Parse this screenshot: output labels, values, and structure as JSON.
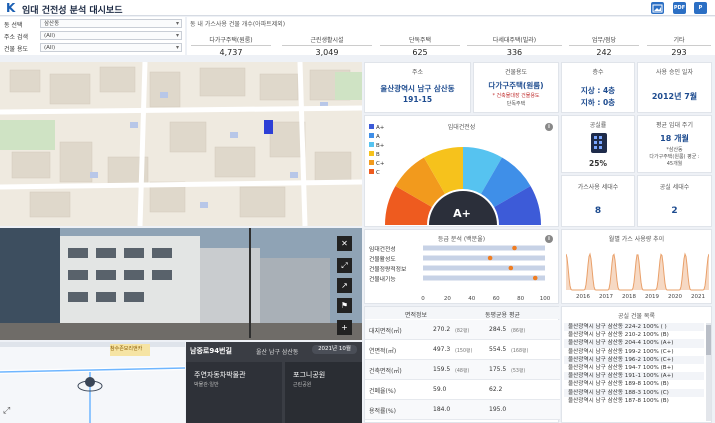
{
  "header": {
    "logo": "K",
    "title": "임대 건전성 분석 대시보드",
    "icons": [
      "image-icon",
      "pdf-icon",
      "ppt-icon"
    ]
  },
  "filters": [
    {
      "label": "동 선택",
      "value": "삼산동"
    },
    {
      "label": "주소 검색",
      "value": "(All)"
    },
    {
      "label": "건물 용도",
      "value": "(All)"
    }
  ],
  "counts": {
    "title": "동 내 가스사용 건물 개수(아파트제외)",
    "columns": [
      {
        "label": "다가구주택(원룸)",
        "value": "4,737"
      },
      {
        "label": "근린생활시설",
        "value": "3,049"
      },
      {
        "label": "단독주택",
        "value": "625"
      },
      {
        "label": "다세대주택(빌라)",
        "value": "336"
      },
      {
        "label": "업무/점당",
        "value": "242"
      },
      {
        "label": "기타",
        "value": "293"
      }
    ]
  },
  "street": {
    "road_label": "남중로94번길",
    "address": "울산 남구 삼산동",
    "date": "2021년 10월",
    "poi1": "주연자동차박물관",
    "poi1_sub": "박물관·일반",
    "poi2": "포그니공원",
    "poi2_sub": "근린공원",
    "map_label": "참수존모리앤카"
  },
  "address_card": {
    "label": "주소",
    "line1": "울산광역시 남구 삼산동",
    "line2": "191-15"
  },
  "use_card": {
    "label": "건물용도",
    "line1": "다가구주택(원룸)",
    "line2": "* 건축물대장 건물용도",
    "line3": "단독주택"
  },
  "floor_card": {
    "label": "층수",
    "above": "지상 : 4층",
    "below": "지하 : 0층"
  },
  "approval_card": {
    "label": "사용 승인 일자",
    "value": "2012년 7월"
  },
  "health": {
    "title": "임대건전성",
    "grade": "A+",
    "legend": [
      "A+",
      "A",
      "B+",
      "B",
      "C+",
      "C"
    ],
    "colors": [
      "#3d5bd8",
      "#3f8fe8",
      "#56c3f0",
      "#f6c21c",
      "#f29a1d",
      "#ee5b1f"
    ]
  },
  "vacancy": {
    "label": "공실률",
    "value": "25%"
  },
  "lease": {
    "label": "평균 임대 주기",
    "value": "18 개월",
    "note1": "*삼산동",
    "note2": "다가구주택(원룸) 평균 :",
    "note3": "45개월"
  },
  "households": {
    "gas_label": "가스사용 세대수",
    "gas_value": "8",
    "vacant_label": "공실 세대수",
    "vacant_value": "2"
  },
  "grade_analysis": {
    "title": "등급 분석 (백분율)",
    "rows": [
      "임대건전성",
      "건물활성도",
      "건물정량적정보",
      "건물내기능"
    ],
    "axis": [
      "0",
      "20",
      "40",
      "60",
      "80",
      "100"
    ],
    "values": [
      75,
      55,
      72,
      92
    ]
  },
  "gas_trend": {
    "title": "월별 가스 사용량 추이",
    "years": [
      "2016",
      "2017",
      "2018",
      "2019",
      "2020",
      "2021"
    ]
  },
  "area_table": {
    "col1": "면적정보",
    "col2": "동평균용 평균",
    "rows": [
      {
        "label": "대지면적(㎡)",
        "v1": "270.2",
        "u1": "(82평)",
        "v2": "284.5",
        "u2": "(86평)"
      },
      {
        "label": "연면적(㎡)",
        "v1": "497.3",
        "u1": "(150평)",
        "v2": "554.5",
        "u2": "(168평)"
      },
      {
        "label": "건축면적(㎡)",
        "v1": "159.5",
        "u1": "(48평)",
        "v2": "175.5",
        "u2": "(53평)"
      },
      {
        "label": "건폐율(%)",
        "v1": "59.0",
        "u1": "",
        "v2": "62.2",
        "u2": ""
      },
      {
        "label": "용적률(%)",
        "v1": "184.0",
        "u1": "",
        "v2": "195.0",
        "u2": ""
      }
    ]
  },
  "similar": {
    "title": "공실 건물 목록",
    "items": [
      "울산광역시 남구 삼산동 224-2   100% (  )",
      "울산광역시 남구 삼산동 210-2   100% (B)",
      "울산광역시 남구 삼산동 204-4   100% (A+)",
      "울산광역시 남구 삼산동 199-2   100% (C+)",
      "울산광역시 남구 삼산동 196-2   100% (C+)",
      "울산광역시 남구 삼산동 194-7   100% (B+)",
      "울산광역시 남구 삼산동 191-1   100% (A+)",
      "울산광역시 남구 삼산동 189-8   100% (B)",
      "울산광역시 남구 삼산동 188-3   100% (C)",
      "울산광역시 남구 삼산동 187-8   100% (B)"
    ]
  }
}
